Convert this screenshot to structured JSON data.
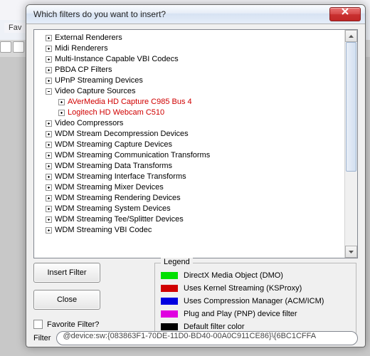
{
  "background": {
    "fav_tab_label": "Fav"
  },
  "dialog": {
    "title": "Which filters do you want to insert?",
    "tree": [
      {
        "level": 0,
        "expander": "plus",
        "label": "External Renderers"
      },
      {
        "level": 0,
        "expander": "plus",
        "label": "Midi Renderers"
      },
      {
        "level": 0,
        "expander": "plus",
        "label": "Multi-Instance Capable VBI Codecs"
      },
      {
        "level": 0,
        "expander": "plus",
        "label": "PBDA CP Filters"
      },
      {
        "level": 0,
        "expander": "plus",
        "label": "UPnP Streaming Devices"
      },
      {
        "level": 0,
        "expander": "minus",
        "label": "Video Capture Sources"
      },
      {
        "level": 1,
        "expander": "plus",
        "label": "AVerMedia HD Capture C985 Bus 4",
        "color": "red"
      },
      {
        "level": 1,
        "expander": "plus",
        "label": "Logitech HD Webcam C510",
        "color": "red"
      },
      {
        "level": 0,
        "expander": "plus",
        "label": "Video Compressors"
      },
      {
        "level": 0,
        "expander": "plus",
        "label": "WDM Stream Decompression Devices"
      },
      {
        "level": 0,
        "expander": "plus",
        "label": "WDM Streaming Capture Devices"
      },
      {
        "level": 0,
        "expander": "plus",
        "label": "WDM Streaming Communication Transforms"
      },
      {
        "level": 0,
        "expander": "plus",
        "label": "WDM Streaming Data Transforms"
      },
      {
        "level": 0,
        "expander": "plus",
        "label": "WDM Streaming Interface Transforms"
      },
      {
        "level": 0,
        "expander": "plus",
        "label": "WDM Streaming Mixer Devices"
      },
      {
        "level": 0,
        "expander": "plus",
        "label": "WDM Streaming Rendering Devices"
      },
      {
        "level": 0,
        "expander": "plus",
        "label": "WDM Streaming System Devices"
      },
      {
        "level": 0,
        "expander": "plus",
        "label": "WDM Streaming Tee/Splitter Devices"
      },
      {
        "level": 0,
        "expander": "plus",
        "label": "WDM Streaming VBI Codec"
      }
    ],
    "buttons": {
      "insert": "Insert Filter",
      "close": "Close"
    },
    "favorite_label": "Favorite Filter?",
    "legend": {
      "title": "Legend",
      "items": [
        {
          "color": "#00e000",
          "label": "DirectX Media Object (DMO)"
        },
        {
          "color": "#d00000",
          "label": "Uses Kernel Streaming (KSProxy)"
        },
        {
          "color": "#0000e0",
          "label": "Uses Compression Manager (ACM/ICM)"
        },
        {
          "color": "#e000e0",
          "label": "Plug and Play (PNP) device filter"
        },
        {
          "color": "#000000",
          "label": "Default filter color"
        }
      ]
    },
    "filter_field": {
      "label": "Filter",
      "value": "@device:sw:{083863F1-70DE-11D0-BD40-00A0C911CE86}\\{6BC1CFFA"
    }
  }
}
